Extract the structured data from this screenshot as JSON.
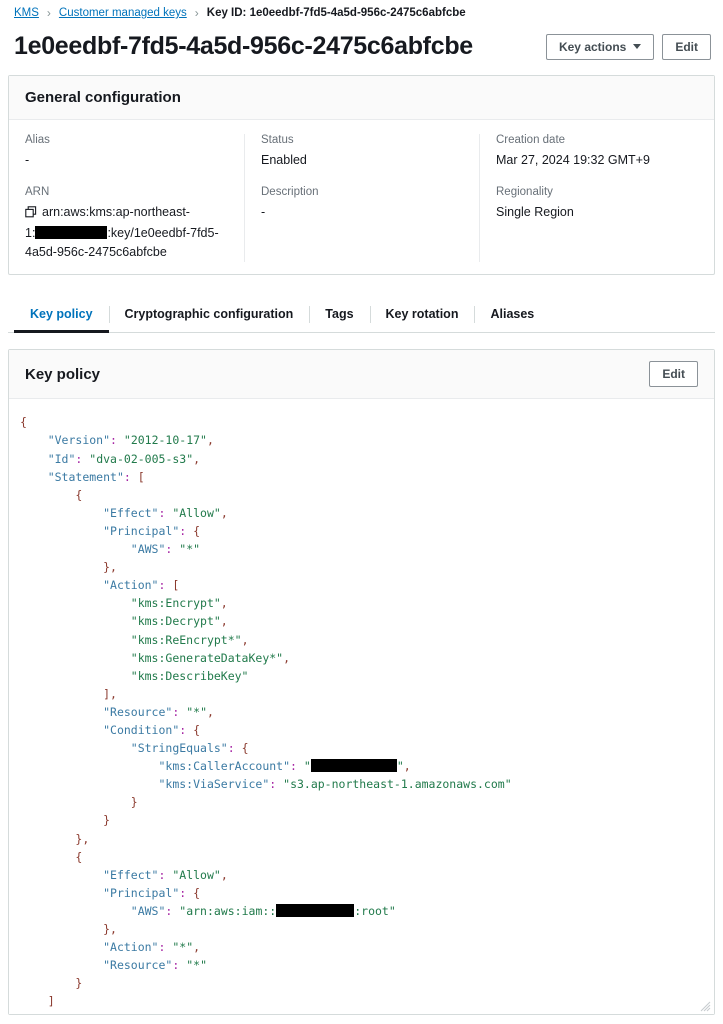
{
  "breadcrumb": {
    "root": "KMS",
    "parent": "Customer managed keys",
    "current": "Key ID: 1e0eedbf-7fd5-4a5d-956c-2475c6abfcbe",
    "separator": "›"
  },
  "header": {
    "title": "1e0eedbf-7fd5-4a5d-956c-2475c6abfcbe",
    "key_actions_label": "Key actions",
    "edit_label": "Edit"
  },
  "general_configuration": {
    "title": "General configuration",
    "alias_label": "Alias",
    "alias_value": "-",
    "arn_label": "ARN",
    "arn_line1": "arn:aws:kms:ap-northeast-",
    "arn_line2_prefix": "1:",
    "arn_line2_suffix": ":key/1e0eedbf-7fd5-",
    "arn_line3": "4a5d-956c-2475c6abfcbe",
    "status_label": "Status",
    "status_value": "Enabled",
    "description_label": "Description",
    "description_value": "-",
    "creation_date_label": "Creation date",
    "creation_date_value": "Mar 27, 2024 19:32 GMT+9",
    "regionality_label": "Regionality",
    "regionality_value": "Single Region"
  },
  "tabs": [
    {
      "label": "Key policy",
      "active": true
    },
    {
      "label": "Cryptographic configuration",
      "active": false
    },
    {
      "label": "Tags",
      "active": false
    },
    {
      "label": "Key rotation",
      "active": false
    },
    {
      "label": "Aliases",
      "active": false
    }
  ],
  "key_policy": {
    "title": "Key policy",
    "edit_label": "Edit",
    "policy": {
      "Version": "2012-10-17",
      "Id": "dva-02-005-s3",
      "Statement": [
        {
          "Effect": "Allow",
          "Principal": {
            "AWS": "*"
          },
          "Action": [
            "kms:Encrypt",
            "kms:Decrypt",
            "kms:ReEncrypt*",
            "kms:GenerateDataKey*",
            "kms:DescribeKey"
          ],
          "Resource": "*",
          "Condition": {
            "StringEquals": {
              "kms:CallerAccount": "[REDACTED]",
              "kms:ViaService": "s3.ap-northeast-1.amazonaws.com"
            }
          }
        },
        {
          "Effect": "Allow",
          "Principal": {
            "AWS": "arn:aws:iam::[REDACTED]:root"
          },
          "Action": "*",
          "Resource": "*"
        }
      ]
    },
    "lines": [
      {
        "indent": 0,
        "parts": [
          {
            "t": "brace",
            "v": "{"
          }
        ]
      },
      {
        "indent": 1,
        "parts": [
          {
            "t": "key",
            "v": "\"Version\""
          },
          {
            "t": "colon",
            "v": ":"
          },
          {
            "t": "plain",
            "v": " "
          },
          {
            "t": "str",
            "v": "\"2012-10-17\""
          },
          {
            "t": "punc",
            "v": ","
          }
        ]
      },
      {
        "indent": 1,
        "parts": [
          {
            "t": "key",
            "v": "\"Id\""
          },
          {
            "t": "colon",
            "v": ":"
          },
          {
            "t": "plain",
            "v": " "
          },
          {
            "t": "str",
            "v": "\"dva-02-005-s3\""
          },
          {
            "t": "punc",
            "v": ","
          }
        ]
      },
      {
        "indent": 1,
        "parts": [
          {
            "t": "key",
            "v": "\"Statement\""
          },
          {
            "t": "colon",
            "v": ":"
          },
          {
            "t": "plain",
            "v": " "
          },
          {
            "t": "brace",
            "v": "["
          }
        ]
      },
      {
        "indent": 2,
        "parts": [
          {
            "t": "brace",
            "v": "{"
          }
        ]
      },
      {
        "indent": 3,
        "parts": [
          {
            "t": "key",
            "v": "\"Effect\""
          },
          {
            "t": "colon",
            "v": ":"
          },
          {
            "t": "plain",
            "v": " "
          },
          {
            "t": "str",
            "v": "\"Allow\""
          },
          {
            "t": "punc",
            "v": ","
          }
        ]
      },
      {
        "indent": 3,
        "parts": [
          {
            "t": "key",
            "v": "\"Principal\""
          },
          {
            "t": "colon",
            "v": ":"
          },
          {
            "t": "plain",
            "v": " "
          },
          {
            "t": "brace",
            "v": "{"
          }
        ]
      },
      {
        "indent": 4,
        "parts": [
          {
            "t": "key",
            "v": "\"AWS\""
          },
          {
            "t": "colon",
            "v": ":"
          },
          {
            "t": "plain",
            "v": " "
          },
          {
            "t": "str",
            "v": "\"*\""
          }
        ]
      },
      {
        "indent": 3,
        "parts": [
          {
            "t": "brace",
            "v": "}"
          },
          {
            "t": "punc",
            "v": ","
          }
        ]
      },
      {
        "indent": 3,
        "parts": [
          {
            "t": "key",
            "v": "\"Action\""
          },
          {
            "t": "colon",
            "v": ":"
          },
          {
            "t": "plain",
            "v": " "
          },
          {
            "t": "brace",
            "v": "["
          }
        ]
      },
      {
        "indent": 4,
        "parts": [
          {
            "t": "str",
            "v": "\"kms:Encrypt\""
          },
          {
            "t": "punc",
            "v": ","
          }
        ]
      },
      {
        "indent": 4,
        "parts": [
          {
            "t": "str",
            "v": "\"kms:Decrypt\""
          },
          {
            "t": "punc",
            "v": ","
          }
        ]
      },
      {
        "indent": 4,
        "parts": [
          {
            "t": "str",
            "v": "\"kms:ReEncrypt*\""
          },
          {
            "t": "punc",
            "v": ","
          }
        ]
      },
      {
        "indent": 4,
        "parts": [
          {
            "t": "str",
            "v": "\"kms:GenerateDataKey*\""
          },
          {
            "t": "punc",
            "v": ","
          }
        ]
      },
      {
        "indent": 4,
        "parts": [
          {
            "t": "str",
            "v": "\"kms:DescribeKey\""
          }
        ]
      },
      {
        "indent": 3,
        "parts": [
          {
            "t": "brace",
            "v": "]"
          },
          {
            "t": "punc",
            "v": ","
          }
        ]
      },
      {
        "indent": 3,
        "parts": [
          {
            "t": "key",
            "v": "\"Resource\""
          },
          {
            "t": "colon",
            "v": ":"
          },
          {
            "t": "plain",
            "v": " "
          },
          {
            "t": "str",
            "v": "\"*\""
          },
          {
            "t": "punc",
            "v": ","
          }
        ]
      },
      {
        "indent": 3,
        "parts": [
          {
            "t": "key",
            "v": "\"Condition\""
          },
          {
            "t": "colon",
            "v": ":"
          },
          {
            "t": "plain",
            "v": " "
          },
          {
            "t": "brace",
            "v": "{"
          }
        ]
      },
      {
        "indent": 4,
        "parts": [
          {
            "t": "key",
            "v": "\"StringEquals\""
          },
          {
            "t": "colon",
            "v": ":"
          },
          {
            "t": "plain",
            "v": " "
          },
          {
            "t": "brace",
            "v": "{"
          }
        ]
      },
      {
        "indent": 5,
        "parts": [
          {
            "t": "key",
            "v": "\"kms:CallerAccount\""
          },
          {
            "t": "colon",
            "v": ":"
          },
          {
            "t": "plain",
            "v": " "
          },
          {
            "t": "str",
            "v": "\""
          },
          {
            "t": "redact",
            "v": "rc-caller"
          },
          {
            "t": "str",
            "v": "\""
          },
          {
            "t": "punc",
            "v": ","
          }
        ]
      },
      {
        "indent": 5,
        "parts": [
          {
            "t": "key",
            "v": "\"kms:ViaService\""
          },
          {
            "t": "colon",
            "v": ":"
          },
          {
            "t": "plain",
            "v": " "
          },
          {
            "t": "str",
            "v": "\"s3.ap-northeast-1.amazonaws.com\""
          }
        ]
      },
      {
        "indent": 4,
        "parts": [
          {
            "t": "brace",
            "v": "}"
          }
        ]
      },
      {
        "indent": 3,
        "parts": [
          {
            "t": "brace",
            "v": "}"
          }
        ]
      },
      {
        "indent": 2,
        "parts": [
          {
            "t": "brace",
            "v": "}"
          },
          {
            "t": "punc",
            "v": ","
          }
        ]
      },
      {
        "indent": 2,
        "parts": [
          {
            "t": "brace",
            "v": "{"
          }
        ]
      },
      {
        "indent": 3,
        "parts": [
          {
            "t": "key",
            "v": "\"Effect\""
          },
          {
            "t": "colon",
            "v": ":"
          },
          {
            "t": "plain",
            "v": " "
          },
          {
            "t": "str",
            "v": "\"Allow\""
          },
          {
            "t": "punc",
            "v": ","
          }
        ]
      },
      {
        "indent": 3,
        "parts": [
          {
            "t": "key",
            "v": "\"Principal\""
          },
          {
            "t": "colon",
            "v": ":"
          },
          {
            "t": "plain",
            "v": " "
          },
          {
            "t": "brace",
            "v": "{"
          }
        ]
      },
      {
        "indent": 4,
        "parts": [
          {
            "t": "key",
            "v": "\"AWS\""
          },
          {
            "t": "colon",
            "v": ":"
          },
          {
            "t": "plain",
            "v": " "
          },
          {
            "t": "str",
            "v": "\"arn:aws:iam::"
          },
          {
            "t": "redact",
            "v": "rc-root"
          },
          {
            "t": "str",
            "v": ":root\""
          }
        ]
      },
      {
        "indent": 3,
        "parts": [
          {
            "t": "brace",
            "v": "}"
          },
          {
            "t": "punc",
            "v": ","
          }
        ]
      },
      {
        "indent": 3,
        "parts": [
          {
            "t": "key",
            "v": "\"Action\""
          },
          {
            "t": "colon",
            "v": ":"
          },
          {
            "t": "plain",
            "v": " "
          },
          {
            "t": "str",
            "v": "\"*\""
          },
          {
            "t": "punc",
            "v": ","
          }
        ]
      },
      {
        "indent": 3,
        "parts": [
          {
            "t": "key",
            "v": "\"Resource\""
          },
          {
            "t": "colon",
            "v": ":"
          },
          {
            "t": "plain",
            "v": " "
          },
          {
            "t": "str",
            "v": "\"*\""
          }
        ]
      },
      {
        "indent": 2,
        "parts": [
          {
            "t": "brace",
            "v": "}"
          }
        ]
      },
      {
        "indent": 1,
        "parts": [
          {
            "t": "brace",
            "v": "]"
          }
        ]
      },
      {
        "indent": 0,
        "parts": [
          {
            "t": "brace",
            "v": "}"
          }
        ]
      }
    ]
  },
  "colors": {
    "link": "#0073bb",
    "text": "#16191f",
    "muted": "#687078",
    "border": "#d5dbdb",
    "card_head_bg": "#fafafa",
    "code_key": "#3b7aa3",
    "code_string": "#217a4b",
    "code_brace": "#8b3a2e",
    "code_colon": "#a626a4"
  }
}
